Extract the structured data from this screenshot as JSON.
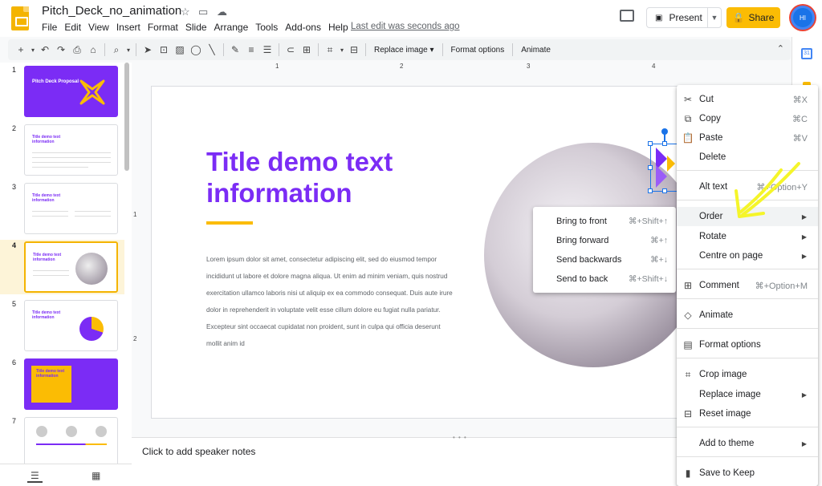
{
  "header": {
    "doc_title": "Pitch_Deck_no_animation",
    "menus": [
      "File",
      "Edit",
      "View",
      "Insert",
      "Format",
      "Slide",
      "Arrange",
      "Tools",
      "Add-ons",
      "Help"
    ],
    "last_edit": "Last edit was seconds ago",
    "present_label": "Present",
    "share_label": "Share",
    "avatar_initials": "HI"
  },
  "toolbar": {
    "replace_image": "Replace image",
    "format_options": "Format options",
    "animate": "Animate"
  },
  "rulers": {
    "h": [
      "1",
      "2",
      "3",
      "4"
    ],
    "v": [
      "1",
      "2"
    ]
  },
  "filmstrip": {
    "slides": [
      {
        "num": "1",
        "title": "Pitch Deck Proposal"
      },
      {
        "num": "2",
        "title": "Title demo text information"
      },
      {
        "num": "3",
        "title": "Title demo text information"
      },
      {
        "num": "4",
        "title": "Title demo text information"
      },
      {
        "num": "5",
        "title": "Title demo text information"
      },
      {
        "num": "6",
        "title": "Title demo text information"
      },
      {
        "num": "7",
        "title": ""
      }
    ]
  },
  "slide": {
    "title": "Title demo text information",
    "body": "Lorem ipsum dolor sit amet, consectetur adipiscing elit, sed do eiusmod tempor incididunt ut labore et dolore magna aliqua. Ut enim ad minim veniam, quis nostrud exercitation ullamco laboris nisi ut aliquip ex ea commodo consequat. Duis aute irure dolor in reprehenderit in voluptate velit esse cillum dolore eu fugiat nulla pariatur. Excepteur sint occaecat cupidatat non proident, sunt in culpa qui officia deserunt mollit anim id"
  },
  "notes": {
    "placeholder": "Click to add speaker notes"
  },
  "context_menu": {
    "cut": {
      "label": "Cut",
      "shortcut": "⌘X"
    },
    "copy": {
      "label": "Copy",
      "shortcut": "⌘C"
    },
    "paste": {
      "label": "Paste",
      "shortcut": "⌘V"
    },
    "delete": {
      "label": "Delete"
    },
    "alt_text": {
      "label": "Alt text",
      "shortcut": "⌘+Option+Y"
    },
    "order": {
      "label": "Order"
    },
    "rotate": {
      "label": "Rotate"
    },
    "centre": {
      "label": "Centre on page"
    },
    "comment": {
      "label": "Comment",
      "shortcut": "⌘+Option+M"
    },
    "animate": {
      "label": "Animate"
    },
    "format_options": {
      "label": "Format options"
    },
    "crop": {
      "label": "Crop image"
    },
    "replace": {
      "label": "Replace image"
    },
    "reset": {
      "label": "Reset image"
    },
    "add_theme": {
      "label": "Add to theme"
    },
    "keep": {
      "label": "Save to Keep"
    }
  },
  "order_submenu": {
    "front": {
      "label": "Bring to front",
      "shortcut": "⌘+Shift+↑"
    },
    "forward": {
      "label": "Bring forward",
      "shortcut": "⌘+↑"
    },
    "backward": {
      "label": "Send backwards",
      "shortcut": "⌘+↓"
    },
    "back": {
      "label": "Send to back",
      "shortcut": "⌘+Shift+↓"
    }
  },
  "colors": {
    "accent": "#7b2cf5",
    "share": "#fbbc04",
    "annotation": "#f5f52a"
  }
}
